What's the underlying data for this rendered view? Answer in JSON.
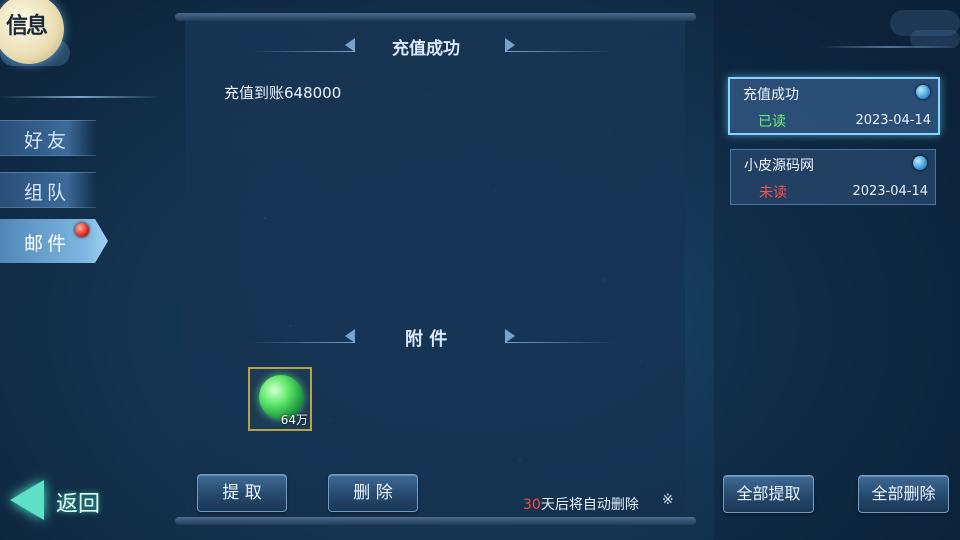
{
  "colors": {
    "accent": "#7fd6ff",
    "read_status": "#6cf07c",
    "unread_status": "#ff4f4f",
    "days_highlight": "#ff4a3a"
  },
  "header": {
    "badge_label": "信息"
  },
  "nav": {
    "items": [
      {
        "label": "好友"
      },
      {
        "label": "组队"
      },
      {
        "label": "邮件",
        "has_notification": true
      }
    ],
    "active": "邮件",
    "back_label": "返回"
  },
  "mail_detail": {
    "title": "充值成功",
    "body": "充值到账648000",
    "attachment_heading": "附 件",
    "attachments": [
      {
        "icon": "green-jade-orb-icon",
        "count_label": "64万"
      }
    ],
    "claim_button": "提 取",
    "delete_button": "删 除",
    "auto_delete_days": "30",
    "auto_delete_suffix": "天后将自动删除",
    "close_symbol": "※"
  },
  "mail_list": {
    "items": [
      {
        "title": "充值成功",
        "status": "已读",
        "date": "2023-04-14",
        "selected": true
      },
      {
        "title": "小皮源码网",
        "status": "未读",
        "date": "2023-04-14",
        "selected": false
      }
    ],
    "claim_all_button": "全部提取",
    "delete_all_button": "全部删除"
  }
}
